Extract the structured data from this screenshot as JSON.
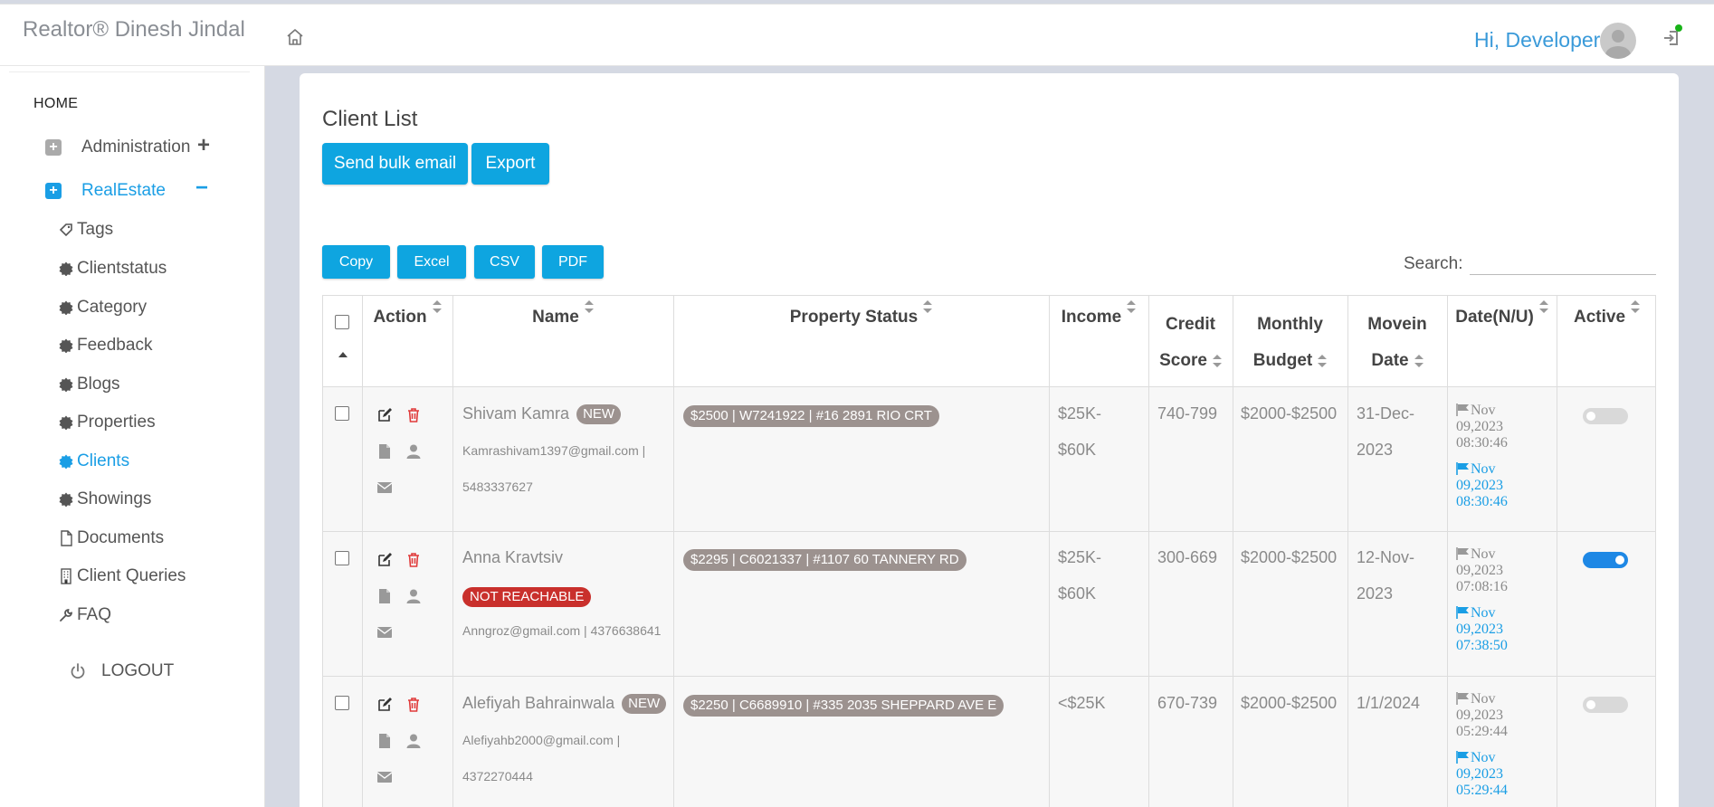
{
  "header": {
    "brand": "Realtor® Dinesh Jindal",
    "greeting": "Hi, Developer",
    "icons": [
      "home-icon",
      "avatar",
      "logout-icon"
    ]
  },
  "sidebar": {
    "home": "HOME",
    "groups": [
      {
        "label": "Administration",
        "toggle": "+",
        "expanded": false
      },
      {
        "label": "RealEstate",
        "toggle": "−",
        "expanded": true
      }
    ],
    "items": [
      {
        "label": "Tags",
        "icon": "tag-icon"
      },
      {
        "label": "Clientstatus",
        "icon": "certificate-icon"
      },
      {
        "label": "Category",
        "icon": "certificate-icon"
      },
      {
        "label": "Feedback",
        "icon": "certificate-icon"
      },
      {
        "label": "Blogs",
        "icon": "certificate-icon"
      },
      {
        "label": "Properties",
        "icon": "certificate-icon"
      },
      {
        "label": "Clients",
        "icon": "certificate-icon",
        "active": true
      },
      {
        "label": "Showings",
        "icon": "certificate-icon"
      },
      {
        "label": "Documents",
        "icon": "file-icon"
      },
      {
        "label": "Client Queries",
        "icon": "building-icon"
      },
      {
        "label": "FAQ",
        "icon": "wrench-icon"
      }
    ],
    "logout": "LOGOUT"
  },
  "main": {
    "title": "Client List",
    "bulk_email": "Send bulk email",
    "export": "Export",
    "tools": [
      "Copy",
      "Excel",
      "CSV",
      "PDF"
    ],
    "search_label": "Search:",
    "search_value": ""
  },
  "table": {
    "headers": {
      "action": "Action",
      "name": "Name",
      "property": "Property Status",
      "income": "Income",
      "credit_1": "Credit",
      "credit_2": "Score",
      "budget_1": "Monthly",
      "budget_2": "Budget",
      "movein_1": "Movein",
      "movein_2": "Date",
      "date": "Date(N/U)",
      "active": "Active"
    },
    "rows": [
      {
        "name": "Shivam Kamra",
        "badge": "NEW",
        "contact_1": "Kamrashivam1397@gmail.com |",
        "contact_2": "5483337627",
        "property": "$2500 | W7241922 | #16 2891 RIO CRT",
        "income_1": "$25K-",
        "income_2": "$60K",
        "credit": "740-799",
        "budget": "$2000-$2500",
        "movein_1": "31-Dec-",
        "movein_2": "2023",
        "created_1": "Nov",
        "created_2": "09,2023",
        "created_3": "08:30:46",
        "updated_1": "Nov",
        "updated_2": "09,2023",
        "updated_3": "08:30:46",
        "active": false
      },
      {
        "name": "Anna Kravtsiv",
        "badge": "NOT REACHABLE",
        "contact_1": "Anngroz@gmail.com | 4376638641",
        "contact_2": "",
        "property": "$2295 | C6021337 | #1107 60 TANNERY RD",
        "income_1": "$25K-",
        "income_2": "$60K",
        "credit": "300-669",
        "budget": "$2000-$2500",
        "movein_1": "12-Nov-",
        "movein_2": "2023",
        "created_1": "Nov",
        "created_2": "09,2023",
        "created_3": "07:08:16",
        "updated_1": "Nov",
        "updated_2": "09,2023",
        "updated_3": "07:38:50",
        "active": true
      },
      {
        "name": "Alefiyah Bahrainwala",
        "badge": "NEW",
        "contact_1": "Alefiyahb2000@gmail.com |",
        "contact_2": "4372270444",
        "property": "$2250 | C6689910 | #335 2035 SHEPPARD AVE E",
        "income_1": "<$25K",
        "income_2": "",
        "credit": "670-739",
        "budget": "$2000-$2500",
        "movein_1": "1/1/2024",
        "movein_2": "",
        "created_1": "Nov",
        "created_2": "09,2023",
        "created_3": "05:29:44",
        "updated_1": "Nov",
        "updated_2": "09,2023",
        "updated_3": "05:29:44",
        "active": false
      }
    ]
  },
  "colors": {
    "accent": "#0ea5e0",
    "link": "#1a9ee5",
    "danger": "#e03b3b",
    "badge": "#9c928f",
    "not_reachable": "#c9302c",
    "toggle_on": "#1e88e5"
  }
}
